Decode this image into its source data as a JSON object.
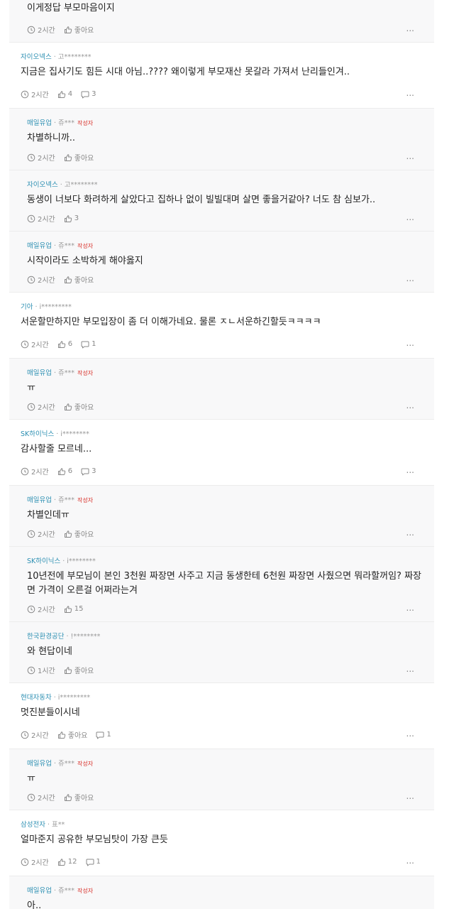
{
  "comments": [
    {
      "type": "reply",
      "company": "",
      "user": "",
      "author": "",
      "text": "이게정답 부모마음이지",
      "time": "2시간",
      "like": "좋아요",
      "reply_count": "",
      "more": "..."
    },
    {
      "type": "top",
      "company": "자이오넥스",
      "user": "고********",
      "author": "",
      "text": "지금은 집사기도 힘든 시대 아님..???? 왜이렇게 부모재산 못갈라 가져서 난리들인겨..",
      "time": "2시간",
      "like": "4",
      "reply_count": "3",
      "more": "..."
    },
    {
      "type": "reply",
      "company": "매일유업",
      "user": "쥬***",
      "author": "작성자",
      "text": "차별하니까..",
      "time": "2시간",
      "like": "좋아요",
      "reply_count": "",
      "more": "..."
    },
    {
      "type": "reply",
      "company": "자이오넥스",
      "user": "고********",
      "author": "",
      "text": "동생이 너보다 화려하게 살았다고 집하나 없이 빌빌대며 살면 좋을거같아? 너도 참 심보가..",
      "time": "2시간",
      "like": "3",
      "reply_count": "",
      "more": "..."
    },
    {
      "type": "reply",
      "company": "매일유업",
      "user": "쥬***",
      "author": "작성자",
      "text": "시작이라도 소박하게 해야옳지",
      "time": "2시간",
      "like": "좋아요",
      "reply_count": "",
      "more": "..."
    },
    {
      "type": "top",
      "company": "기아",
      "user": "i*********",
      "author": "",
      "text": "서운할만하지만 부모입장이 좀 더 이해가네요. 물론 ㅈㄴ서운하긴할듯ㅋㅋㅋㅋ",
      "time": "2시간",
      "like": "6",
      "reply_count": "1",
      "more": "..."
    },
    {
      "type": "reply",
      "company": "매일유업",
      "user": "쥬***",
      "author": "작성자",
      "text": "ㅠ",
      "time": "2시간",
      "like": "좋아요",
      "reply_count": "",
      "more": "..."
    },
    {
      "type": "top",
      "company": "SK하이닉스",
      "user": "i********",
      "author": "",
      "text": "감사할줄 모르네...",
      "time": "2시간",
      "like": "6",
      "reply_count": "3",
      "more": "..."
    },
    {
      "type": "reply",
      "company": "매일유업",
      "user": "쥬***",
      "author": "작성자",
      "text": "차별인데ㅠ",
      "time": "2시간",
      "like": "좋아요",
      "reply_count": "",
      "more": "..."
    },
    {
      "type": "reply",
      "company": "SK하이닉스",
      "user": "i********",
      "author": "",
      "text": "10년전에 부모님이 본인 3천원 짜장면 사주고 지금 동생한테 6천원 짜장면 사줬으면 뭐라할꺼임? 짜장면 가격이 오른걸 어쩌라는겨",
      "time": "2시간",
      "like": "15",
      "reply_count": "",
      "more": "..."
    },
    {
      "type": "reply",
      "company": "한국환경공단",
      "user": "!********",
      "author": "",
      "text": "와 현답이네",
      "time": "1시간",
      "like": "좋아요",
      "reply_count": "",
      "more": "..."
    },
    {
      "type": "top",
      "company": "현대자동차",
      "user": "i*********",
      "author": "",
      "text": "멋진분들이시네",
      "time": "2시간",
      "like": "좋아요",
      "reply_count": "1",
      "more": "..."
    },
    {
      "type": "reply",
      "company": "매일유업",
      "user": "쥬***",
      "author": "작성자",
      "text": "ㅠ",
      "time": "2시간",
      "like": "좋아요",
      "reply_count": "",
      "more": "..."
    },
    {
      "type": "top",
      "company": "삼성전자",
      "user": "표**",
      "author": "",
      "text": "얼마준지 공유한 부모님탓이 가장 큰듯",
      "time": "2시간",
      "like": "12",
      "reply_count": "1",
      "more": "..."
    },
    {
      "type": "reply",
      "company": "매일유업",
      "user": "쥬***",
      "author": "작성자",
      "text": "아..",
      "time": "",
      "like": "",
      "reply_count": "",
      "more": ""
    }
  ]
}
